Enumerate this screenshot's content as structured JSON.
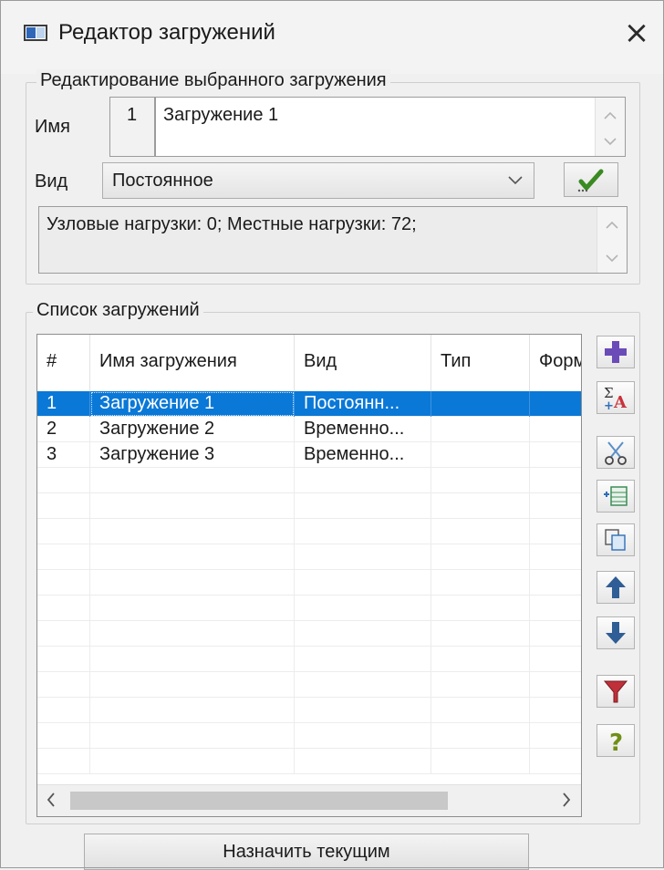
{
  "window": {
    "title": "Редактор загружений",
    "close_glyph": "×"
  },
  "edit_group": {
    "legend": "Редактирование выбранного загружения",
    "name_label": "Имя",
    "number": "1",
    "name_value": "Загружение 1",
    "type_label": "Вид",
    "type_value": "Постоянное",
    "info_text": "Узловые нагрузки:  0;  Местные нагрузки:  72;"
  },
  "list_group": {
    "legend": "Список загружений",
    "columns": [
      "#",
      "Имя загружения",
      "Вид",
      "Тип",
      "Форм"
    ],
    "rows": [
      {
        "num": "1",
        "name": "Загружение 1",
        "type": "Постоянн...",
        "kind": "",
        "form": "",
        "selected": true
      },
      {
        "num": "2",
        "name": "Загружение 2",
        "type": "Временно...",
        "kind": "",
        "form": "",
        "selected": false
      },
      {
        "num": "3",
        "name": "Загружение 3",
        "type": "Временно...",
        "kind": "",
        "form": "",
        "selected": false
      }
    ]
  },
  "toolbar": {
    "buttons": [
      "add-icon",
      "sum-loads-icon",
      "scissors-icon",
      "insert-row-icon",
      "copy-icon",
      "arrow-up-icon",
      "arrow-down-icon",
      "filter-icon",
      "help-icon"
    ],
    "accent_blue": "#0a78d7",
    "add_color": "#6a4bb8",
    "check_color": "#3a8a22",
    "filter_color": "#c0303a"
  },
  "assign_button": {
    "label": "Назначить текущим"
  }
}
